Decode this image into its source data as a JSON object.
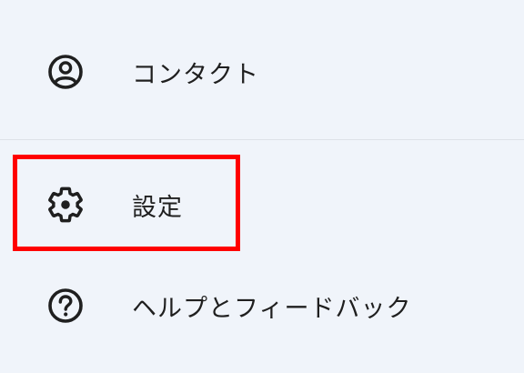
{
  "menu": {
    "items": [
      {
        "label": "コンタクト",
        "icon": "account-circle-icon"
      },
      {
        "label": "設定",
        "icon": "gear-icon"
      },
      {
        "label": "ヘルプとフィードバック",
        "icon": "help-circle-icon"
      }
    ]
  },
  "annotation": {
    "highlight_color": "#ff0000",
    "highlighted_item": "設定"
  },
  "colors": {
    "background": "#f0f4fa",
    "text": "#1f1f1f",
    "divider": "#dde1e7"
  }
}
